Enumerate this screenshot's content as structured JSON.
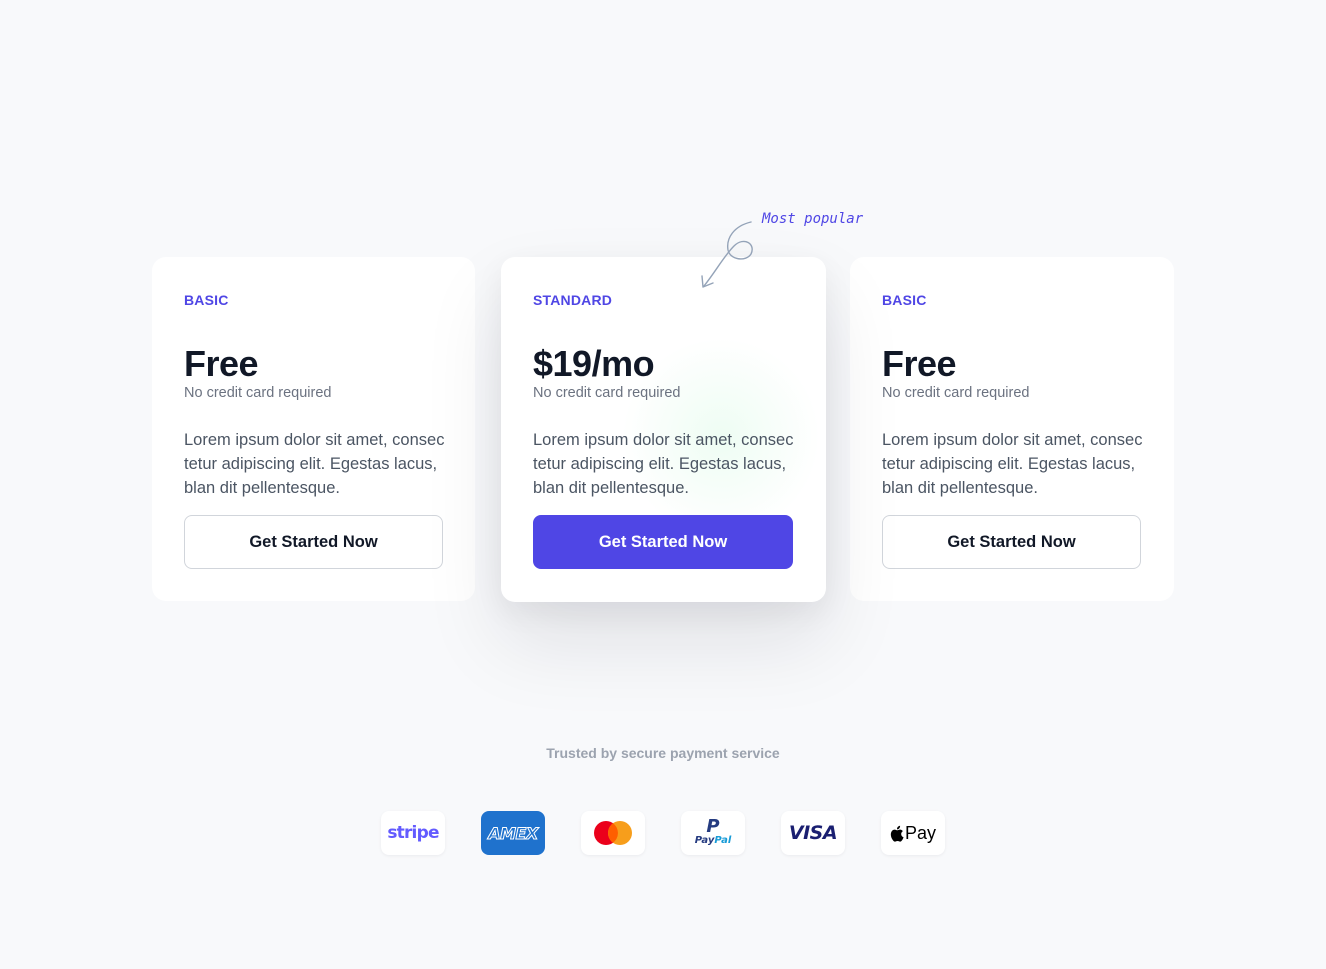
{
  "popular_note": "Most popular",
  "plans": [
    {
      "name": "BASIC",
      "price": "Free",
      "price_note": "No credit card required",
      "description": "Lorem ipsum dolor sit amet, consec tetur adipiscing elit. Egestas lacus, blan dit pellentesque.",
      "cta_label": "Get Started Now",
      "highlighted": false
    },
    {
      "name": "STANDARD",
      "price": "$19/mo",
      "price_note": "No credit card required",
      "description": "Lorem ipsum dolor sit amet, consec tetur adipiscing elit. Egestas lacus, blan dit pellentesque.",
      "cta_label": "Get Started Now",
      "highlighted": true
    },
    {
      "name": "BASIC",
      "price": "Free",
      "price_note": "No credit card required",
      "description": "Lorem ipsum dolor sit amet, consec tetur adipiscing elit. Egestas lacus, blan dit pellentesque.",
      "cta_label": "Get Started Now",
      "highlighted": false
    }
  ],
  "trusted_text": "Trusted by secure payment service",
  "payment_logos": {
    "stripe": "stripe",
    "amex": "AMEX",
    "mastercard": "mastercard-logo",
    "paypal": {
      "mark": "P",
      "pay": "Pay",
      "pal": "Pal"
    },
    "visa": "VISA",
    "applepay": "Pay"
  },
  "colors": {
    "accent": "#4f46e5",
    "background": "#f8f9fb",
    "text_dark": "#111827",
    "text_muted": "#6b7280",
    "amex_blue": "#1f72cd",
    "mastercard_red": "#eb001b",
    "mastercard_orange": "#f79e1b"
  }
}
